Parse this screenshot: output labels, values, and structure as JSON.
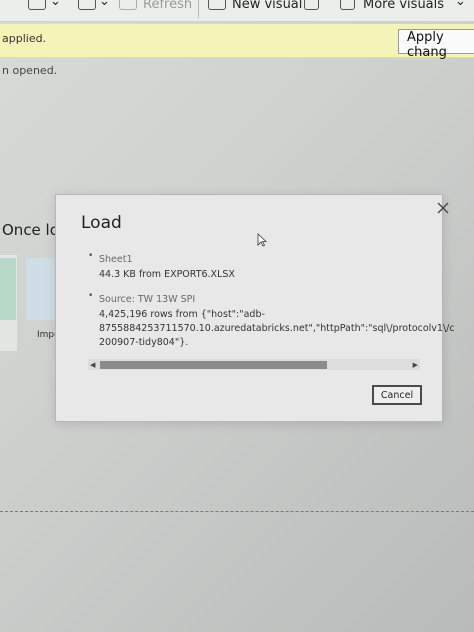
{
  "toolbar": {
    "refresh_label": "Refresh",
    "new_visual_label": "New visual",
    "more_visuals_label": "More visuals"
  },
  "notice": {
    "text": "applied.",
    "apply_label": "Apply chang"
  },
  "background": {
    "opened_text": "n opened.",
    "once_text": "Once loa",
    "import_text": "Impor"
  },
  "dialog": {
    "title": "Load",
    "item1_name": "Sheet1",
    "item1_detail": "44.3 KB from EXPORT6.XLSX",
    "item2_name": "Source: TW 13W SPI",
    "item2_line1": "4,425,196 rows from {\"host\":\"adb-",
    "item2_line2": "8755884253711570.10.azuredatabricks.net\",\"httpPath\":\"sql\\/protocolv1\\/c",
    "item2_line3": "200907-tidy804\"}.",
    "cancel_label": "Cancel"
  }
}
